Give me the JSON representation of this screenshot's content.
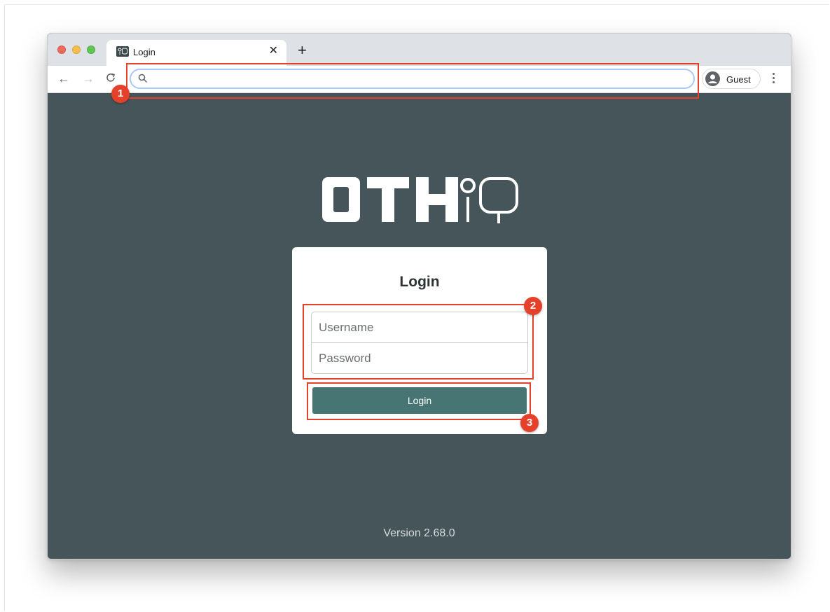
{
  "browser": {
    "tab": {
      "title": "Login",
      "favicon_text": "ꝭ▢",
      "close_label": "✕"
    },
    "new_tab_label": "+",
    "nav": {
      "back": "←",
      "forward": "→",
      "reload": "C"
    },
    "omnibox": {
      "value": "",
      "placeholder": ""
    },
    "profile": {
      "label": "Guest"
    }
  },
  "page": {
    "logo_text": "OTH iQ",
    "login_card": {
      "title": "Login",
      "username_placeholder": "Username",
      "password_placeholder": "Password",
      "submit_label": "Login"
    },
    "version": "Version 2.68.0"
  },
  "annotations": [
    {
      "number": "1",
      "target": "address-bar"
    },
    {
      "number": "2",
      "target": "credential-fields"
    },
    {
      "number": "3",
      "target": "login-button"
    }
  ],
  "colors": {
    "page_background": "#465559",
    "button": "#467573",
    "annotation": "#e5402a",
    "omnibox_focus": "#a8c7fa"
  }
}
